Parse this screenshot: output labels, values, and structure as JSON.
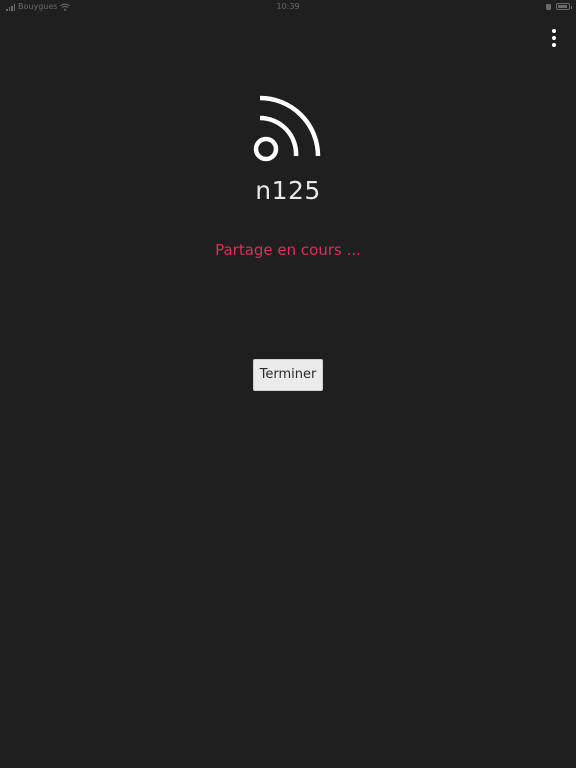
{
  "status_bar": {
    "carrier": "Bouygues",
    "time": "10:39",
    "signal_icon": "cellular-signal-icon",
    "wifi_icon": "wifi-icon",
    "lock_icon": "orientation-lock-icon",
    "battery_icon": "battery-icon"
  },
  "toolbar": {
    "more_icon": "more-vertical-icon"
  },
  "share": {
    "icon": "broadcast-icon",
    "device_name": "n125",
    "status_message": "Partage en cours ...",
    "end_button_label": "Terminer"
  },
  "colors": {
    "background": "#1f1f1f",
    "status_message": "#d6305c",
    "icon": "#ffffff",
    "button_background": "#ebebeb"
  }
}
